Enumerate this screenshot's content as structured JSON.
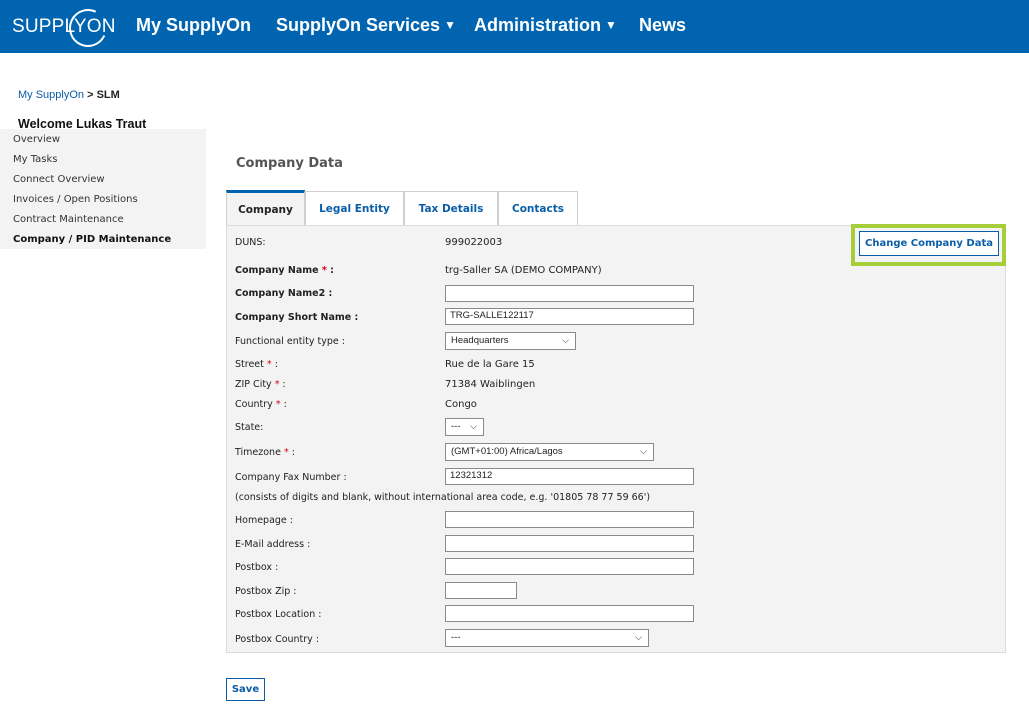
{
  "header": {
    "logo_text": "SUPPLYON",
    "nav": [
      "My SupplyOn",
      "SupplyOn Services",
      "Administration",
      "News"
    ],
    "dropdown_caret": "▼"
  },
  "breadcrumb": {
    "home": "My SupplyOn",
    "separator": ">",
    "current": "SLM"
  },
  "welcome": "Welcome Lukas Traut",
  "sidebar": {
    "items": [
      "Overview",
      "My Tasks",
      "Connect Overview",
      "Invoices / Open Positions",
      "Contract Maintenance",
      "Company / PID Maintenance"
    ],
    "active_index": 5
  },
  "page_title": "Company Data",
  "tabs": [
    "Company",
    "Legal Entity",
    "Tax Details",
    "Contacts"
  ],
  "actions": {
    "change_company_data": "Change Company Data",
    "save": "Save"
  },
  "form": {
    "duns_label": "DUNS:",
    "duns_value": "999022003",
    "company_name_label": "Company Name",
    "company_name_value": "trg-Saller SA (DEMO COMPANY)",
    "company_name2_label": "Company Name2 :",
    "company_name2_value": "",
    "short_name_label": "Company Short Name :",
    "short_name_value": "TRG-SALLE122117",
    "entity_type_label": "Functional entity type :",
    "entity_type_value": "Headquarters",
    "street_label": "Street",
    "street_value": "Rue de la Gare 15",
    "zip_city_label": "ZIP City",
    "zip_city_value": "71384 Waiblingen",
    "country_label": "Country",
    "country_value": "Congo",
    "state_label": "State:",
    "state_value": "---",
    "timezone_label": "Timezone",
    "timezone_value": "(GMT+01:00) Africa/Lagos",
    "fax_label": "Company Fax Number :",
    "fax_value": "12321312",
    "fax_hint": "(consists of digits and blank, without international area code, e.g. '01805 78 77 59 66')",
    "homepage_label": "Homepage :",
    "email_label": "E-Mail address :",
    "postbox_label": "Postbox :",
    "postbox_zip_label": "Postbox Zip :",
    "postbox_location_label": "Postbox Location :",
    "postbox_country_label": "Postbox Country :",
    "postbox_country_value": "---",
    "required_marker": "*",
    "colon": ":"
  },
  "colors": {
    "brand_blue": "#0064b0",
    "link_blue": "#0a5ea8",
    "highlight_green": "#a6ce39",
    "required_red": "#d0021b"
  }
}
